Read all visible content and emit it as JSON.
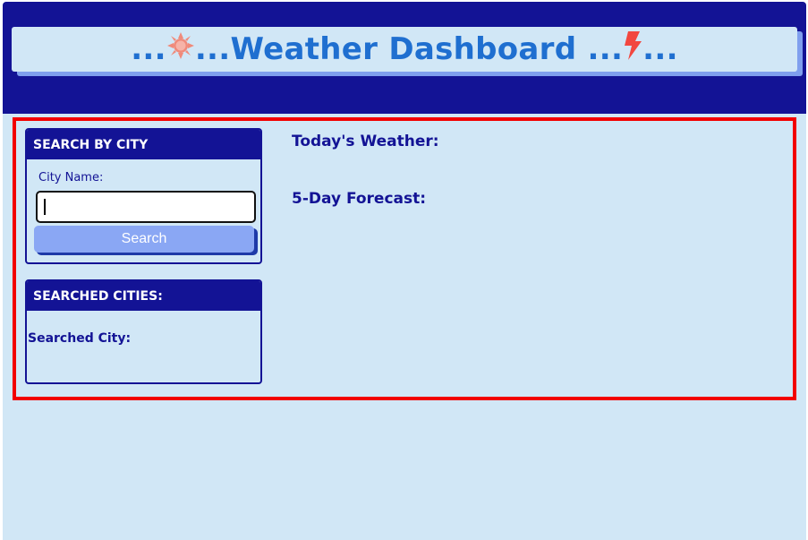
{
  "header": {
    "title_prefix": "...",
    "title_middle_left": "...",
    "title_text": " Weather Dashboard ...",
    "title_suffix": "...",
    "left_icon": "sun-icon",
    "right_icon": "lightning-bolt-icon",
    "title_color": "#1f6fd0",
    "left_icon_color": "#f08a7a",
    "right_icon_color": "#f2473f"
  },
  "search_panel": {
    "heading": "SEARCH BY CITY",
    "city_label": "City Name:",
    "input_value": "",
    "button_label": "Search"
  },
  "history_panel": {
    "heading": "SEARCHED CITIES:",
    "searched_city_label": "Searched City:"
  },
  "main": {
    "today_heading": "Today's Weather:",
    "forecast_heading": "5-Day Forecast:"
  },
  "colors": {
    "navy": "#131395",
    "background": "#d1e7f6",
    "highlight_border": "#f20000",
    "button": "#8aa7f4"
  }
}
